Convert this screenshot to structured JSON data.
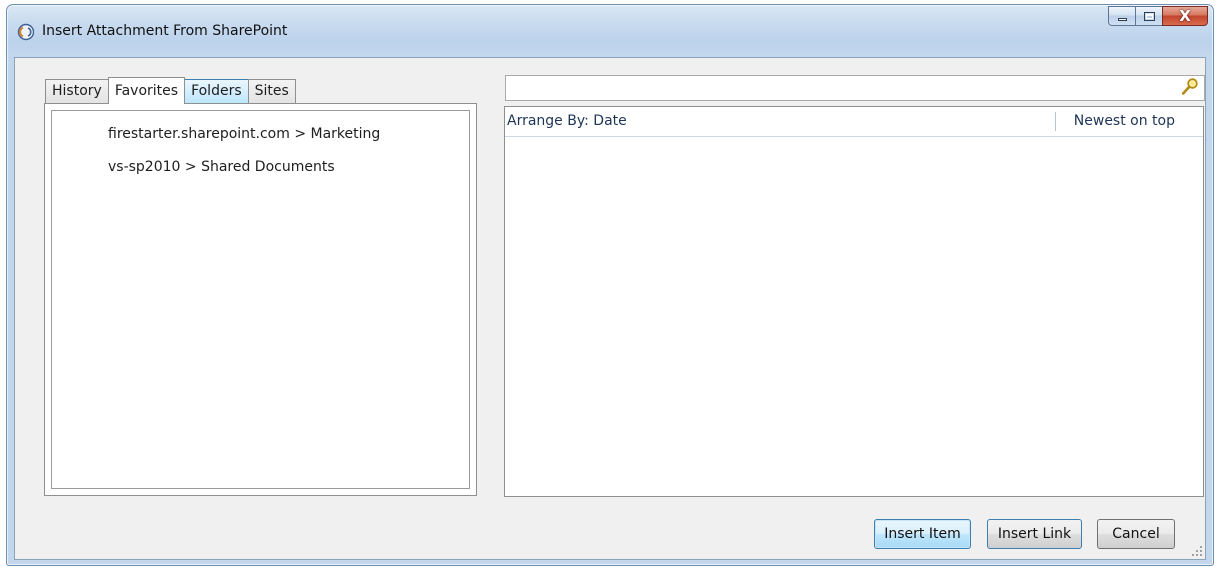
{
  "window": {
    "title": "Insert Attachment From SharePoint",
    "app_icon": "sharepoint-circle-icon",
    "caption_buttons": [
      "minimize-icon",
      "maximize-icon",
      "close-icon"
    ],
    "close_glyph": "X"
  },
  "tabs": [
    {
      "label": "History",
      "state": "normal"
    },
    {
      "label": "Favorites",
      "state": "selected"
    },
    {
      "label": "Folders",
      "state": "hover"
    },
    {
      "label": "Sites",
      "state": "normal"
    }
  ],
  "favorites": {
    "items": [
      "firestarter.sharepoint.com > Marketing",
      "vs-sp2010 > Shared Documents"
    ]
  },
  "search": {
    "value": "",
    "placeholder": "",
    "icon": "search-magnifier-icon"
  },
  "results": {
    "arrange_by": "Arrange By: Date",
    "sort_order": "Newest on top"
  },
  "buttons": {
    "insert_item": "Insert Item",
    "insert_link": "Insert Link",
    "cancel": "Cancel"
  },
  "colors": {
    "title_bar": "#c9dbef",
    "client_bg": "#f0f0f0",
    "accent_border": "#3c7fb1",
    "close_button": "#c1452c"
  }
}
